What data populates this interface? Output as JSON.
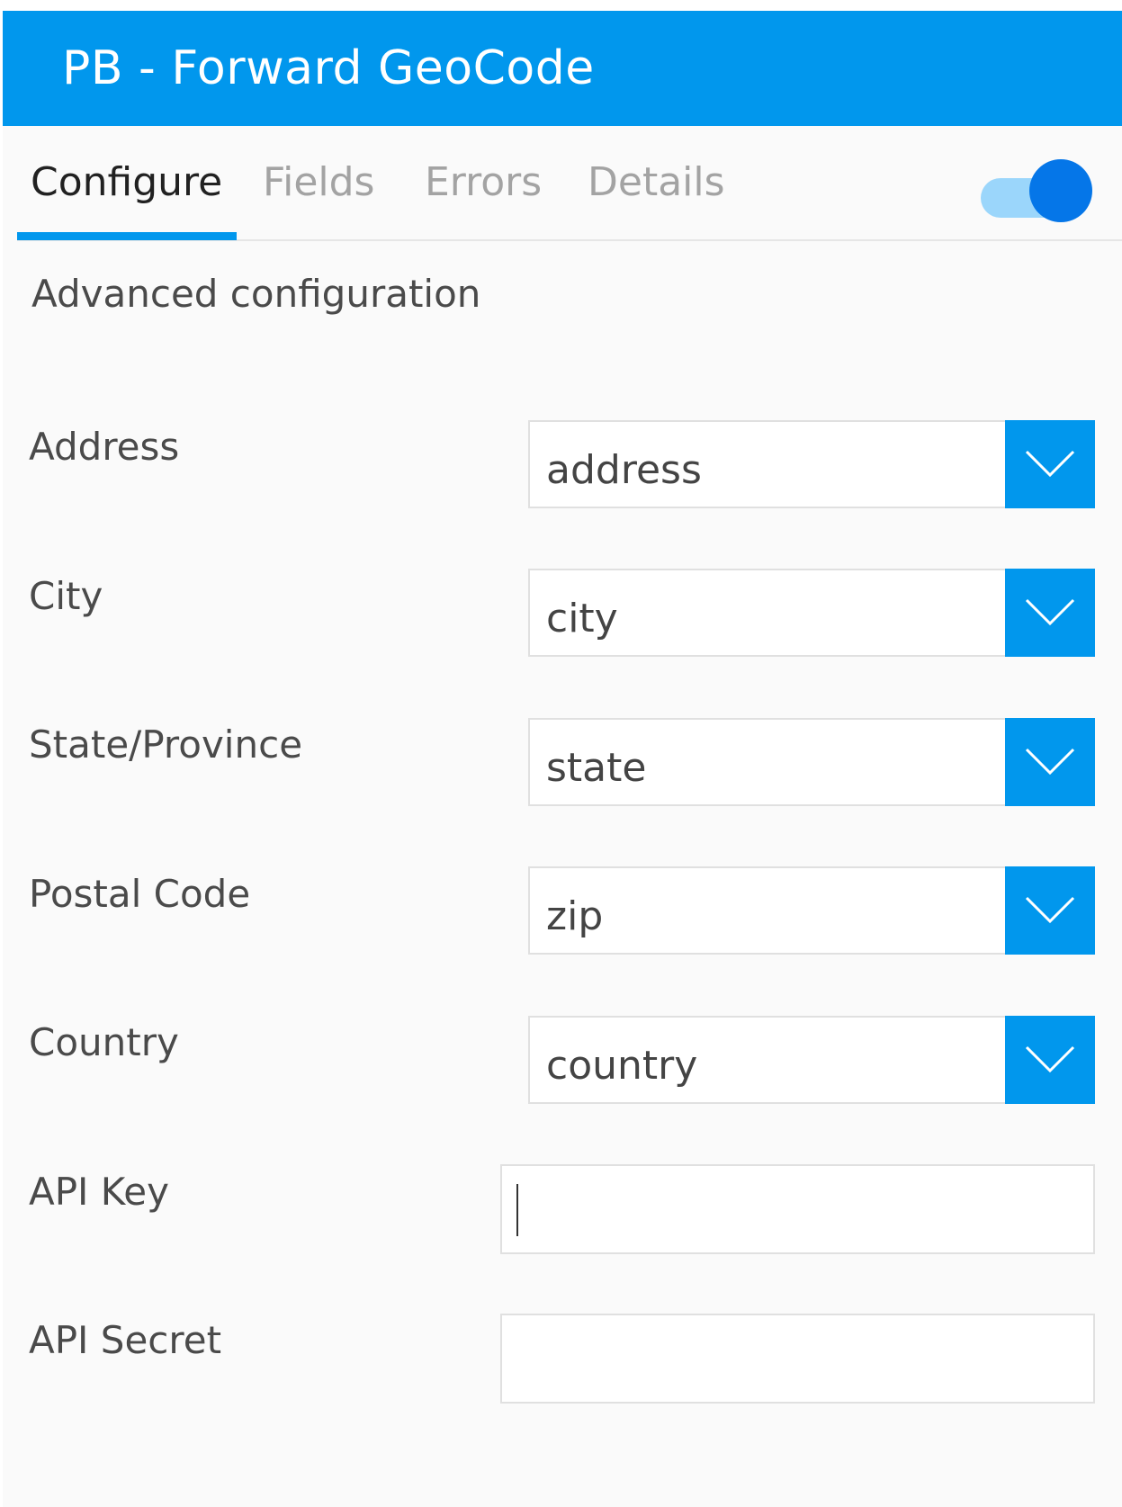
{
  "dialog": {
    "title": "PB - Forward GeoCode"
  },
  "tabs": [
    {
      "label": "Configure",
      "active": true
    },
    {
      "label": "Fields",
      "active": false
    },
    {
      "label": "Errors",
      "active": false
    },
    {
      "label": "Details",
      "active": false
    }
  ],
  "advanced": {
    "label": "Advanced configuration",
    "enabled": true
  },
  "fields": {
    "address": {
      "label": "Address",
      "value": "address"
    },
    "city": {
      "label": "City",
      "value": "city"
    },
    "state": {
      "label": "State/Province",
      "value": "state"
    },
    "postal": {
      "label": "Postal Code",
      "value": "zip"
    },
    "country": {
      "label": "Country",
      "value": "country"
    },
    "api_key": {
      "label": "API Key",
      "value": ""
    },
    "api_secret": {
      "label": "API Secret",
      "value": ""
    }
  },
  "colors": {
    "accent": "#0197ed",
    "toggle_track": "#9bd6fb",
    "toggle_knob": "#0576e8"
  },
  "icons": {
    "dropdown": "chevron-down-icon"
  }
}
